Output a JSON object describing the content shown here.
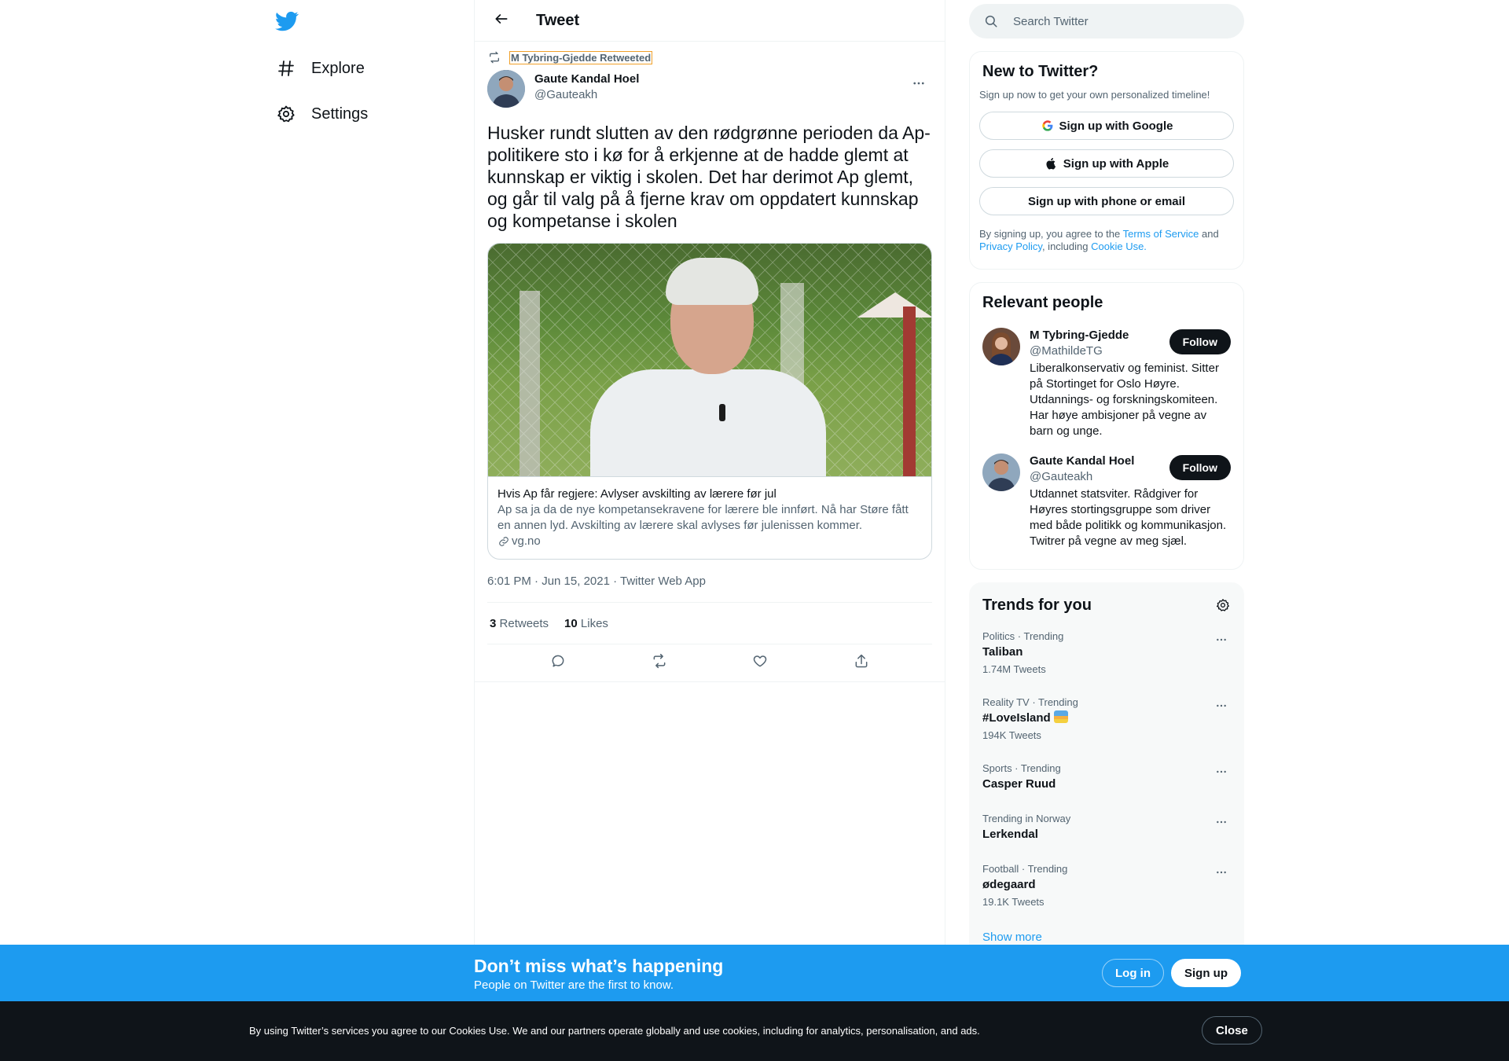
{
  "nav": {
    "items": [
      {
        "label": "Explore",
        "icon": "hashtag-icon"
      },
      {
        "label": "Settings",
        "icon": "gear-icon"
      }
    ]
  },
  "header": {
    "title": "Tweet"
  },
  "tweet": {
    "retweeted_by": "M Tybring-Gjedde Retweeted",
    "author_name": "Gaute Kandal Hoel",
    "author_handle": "@Gauteakh",
    "text": "Husker rundt slutten av den rødgrønne perioden da Ap-politikere sto i kø for å erkjenne at de hadde glemt at kunnskap er viktig i skolen. Det har derimot Ap glemt, og går til valg på å fjerne krav om oppdatert kunnskap og kompetanse i skolen",
    "card": {
      "title": "Hvis Ap får regjere: Avlyser avskilting av lærere før jul",
      "description": "Ap sa ja da de nye kompetansekravene for lærere ble innført. Nå har Støre fått en annen lyd. Avskilting av lærere skal avlyses før julenissen kommer.",
      "domain": "vg.no"
    },
    "timestamp": "6:01 PM · Jun 15, 2021 · Twitter Web App",
    "retweets_count": "3",
    "retweets_label": "Retweets",
    "likes_count": "10",
    "likes_label": "Likes"
  },
  "search": {
    "placeholder": "Search Twitter"
  },
  "new_to_twitter": {
    "title": "New to Twitter?",
    "subtitle": "Sign up now to get your own personalized timeline!",
    "google": "Sign up with Google",
    "apple": "Sign up with Apple",
    "phone": "Sign up with phone or email",
    "legal_1": "By signing up, you agree to the ",
    "terms": "Terms of Service",
    "legal_2": " and ",
    "privacy": "Privacy Policy",
    "legal_3": ", including ",
    "cookie": "Cookie Use."
  },
  "relevant_people": {
    "title": "Relevant people",
    "people": [
      {
        "name": "M Tybring-Gjedde",
        "handle": "@MathildeTG",
        "bio": "Liberalkonservativ og feminist. Sitter på Stortinget for Oslo Høyre. Utdannings- og forskningskomiteen. Har høye ambisjoner på vegne av barn og unge.",
        "follow": "Follow"
      },
      {
        "name": "Gaute Kandal Hoel",
        "handle": "@Gauteakh",
        "bio": "Utdannet statsviter. Rådgiver for Høyres stortingsgruppe som driver med både politikk og kommunikasjon. Twitrer på vegne av meg sjæl.",
        "follow": "Follow"
      }
    ]
  },
  "trends": {
    "title": "Trends for you",
    "items": [
      {
        "context": "Politics · Trending",
        "name": "Taliban",
        "count": "1.74M Tweets"
      },
      {
        "context": "Reality TV · Trending",
        "name": "#LoveIsland",
        "count": "194K Tweets"
      },
      {
        "context": "Sports · Trending",
        "name": "Casper Ruud",
        "count": ""
      },
      {
        "context": "Trending in Norway",
        "name": "Lerkendal",
        "count": ""
      },
      {
        "context": "Football · Trending",
        "name": "ødegaard",
        "count": "19.1K Tweets"
      }
    ],
    "show_more": "Show more"
  },
  "banner": {
    "title": "Don’t miss what’s happening",
    "subtitle": "People on Twitter are the first to know.",
    "login": "Log in",
    "signup": "Sign up"
  },
  "cookie_bar": {
    "text": "By using Twitter’s services you agree to our Cookies Use. We and our partners operate globally and use cookies, including for analytics, personalisation, and ads.",
    "close": "Close"
  },
  "colors": {
    "brand": "#1d9bf0",
    "text": "#0f1419",
    "secondary": "#536471",
    "dark": "#0f1419"
  }
}
